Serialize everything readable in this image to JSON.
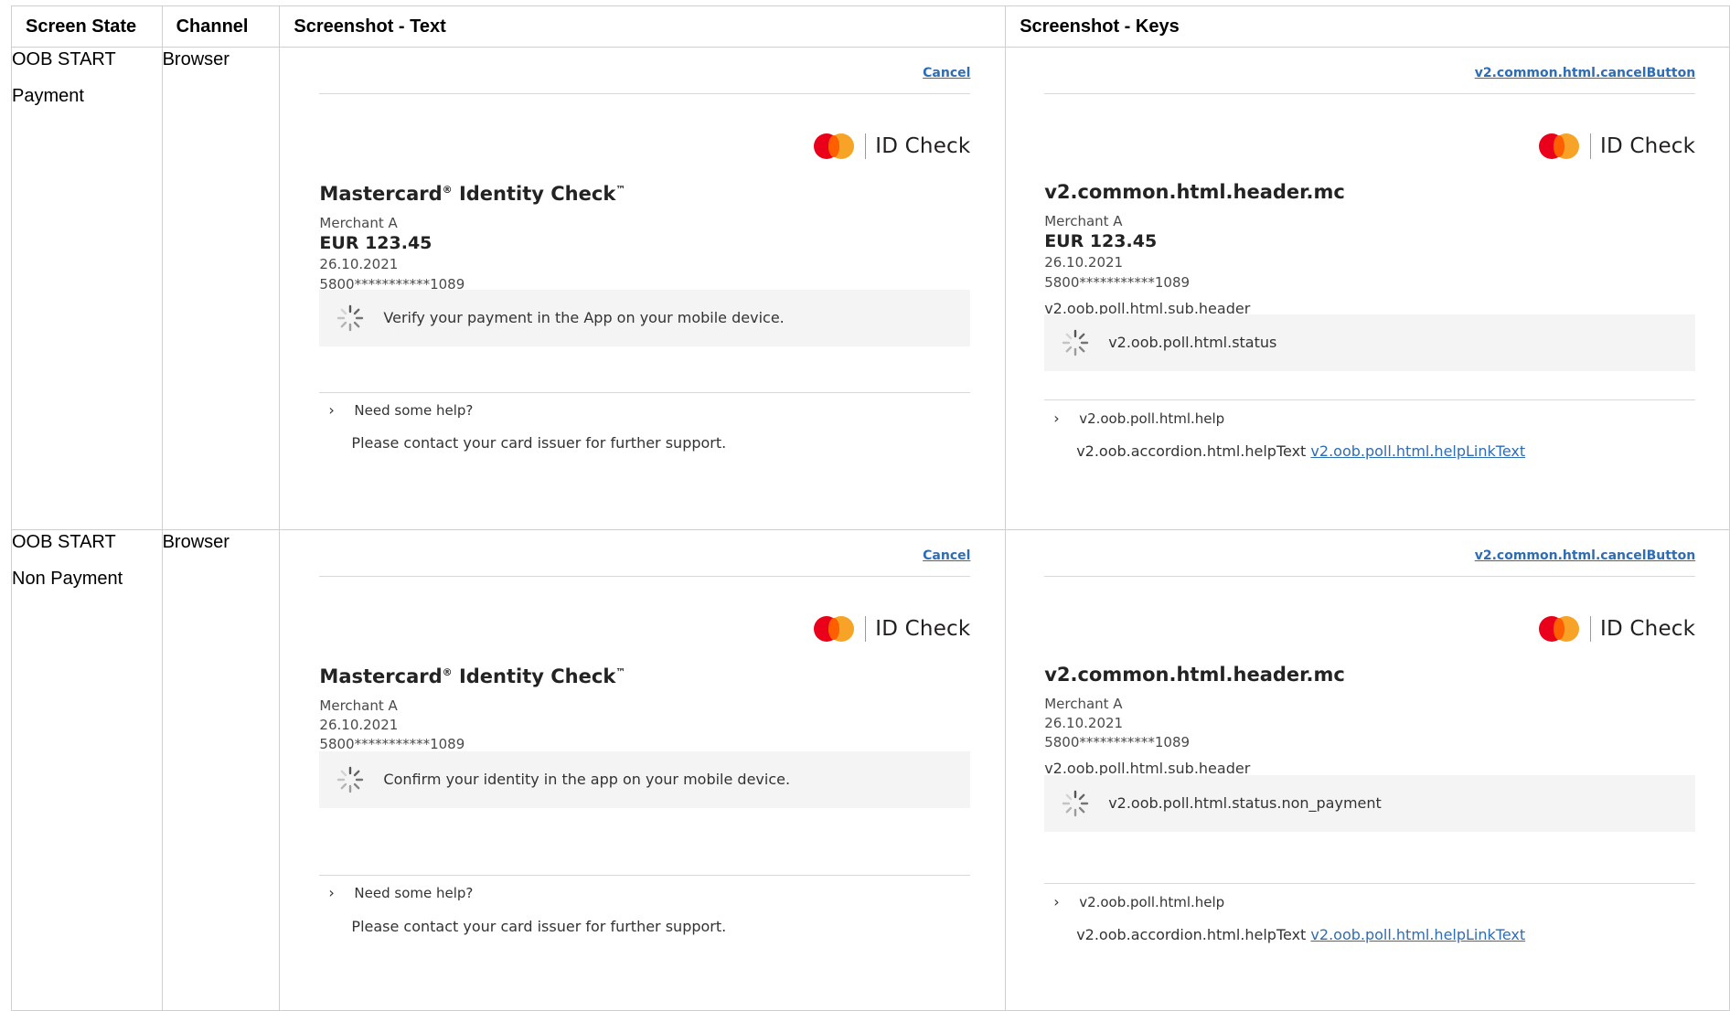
{
  "table": {
    "headers": [
      "Screen State",
      "Channel",
      "Screenshot - Text",
      "Screenshot - Keys"
    ]
  },
  "rows": [
    {
      "state": [
        "OOB START",
        "Payment"
      ],
      "channel": "Browser",
      "text_panel": {
        "cancel": "Cancel",
        "brand": "ID Check",
        "title": "Mastercard",
        "title_reg": "®",
        "title_rest": " Identity Check",
        "title_tm": "™",
        "merchant": "Merchant A",
        "amount": "EUR 123.45",
        "date": "26.10.2021",
        "pan": "5800***********1089",
        "status": "Verify your payment in the App on your mobile device.",
        "help": "Need some help?",
        "help_text": "Please contact your card issuer for further support."
      },
      "keys_panel": {
        "cancel": "v2.common.html.cancelButton",
        "brand": "ID Check",
        "title": "v2.common.html.header.mc",
        "merchant": "Merchant A",
        "amount": "EUR 123.45",
        "date": "26.10.2021",
        "pan": "5800***********1089",
        "sub_header": "v2.oob.poll.html.sub.header",
        "status": "v2.oob.poll.html.status",
        "help": "v2.oob.poll.html.help",
        "help_text": "v2.oob.accordion.html.helpText",
        "help_link": "v2.oob.poll.html.helpLinkText"
      }
    },
    {
      "state": [
        "OOB START",
        "Non Payment"
      ],
      "channel": "Browser",
      "text_panel": {
        "cancel": "Cancel",
        "brand": "ID Check",
        "title": "Mastercard",
        "title_reg": "®",
        "title_rest": " Identity Check",
        "title_tm": "™",
        "merchant": "Merchant A",
        "date": "26.10.2021",
        "pan": "5800***********1089",
        "status": "Confirm your identity in the app on your mobile device.",
        "help": "Need some help?",
        "help_text": "Please contact your card issuer for further support."
      },
      "keys_panel": {
        "cancel": "v2.common.html.cancelButton",
        "brand": "ID Check",
        "title": "v2.common.html.header.mc",
        "merchant": "Merchant A",
        "date": "26.10.2021",
        "pan": "5800***********1089",
        "sub_header": "v2.oob.poll.html.sub.header",
        "status": "v2.oob.poll.html.status.non_payment",
        "help": "v2.oob.poll.html.help",
        "help_text": "v2.oob.accordion.html.helpText",
        "help_link": "v2.oob.poll.html.helpLinkText"
      }
    }
  ],
  "colors": {
    "link": "#2f6db3",
    "mc_red": "#eb001b",
    "mc_orange": "#f79e1b",
    "status_bg": "#f4f4f4",
    "border": "#cfcfcf"
  },
  "icons": [
    "mastercard-logo-icon",
    "spinner-icon",
    "chevron-right-icon"
  ]
}
